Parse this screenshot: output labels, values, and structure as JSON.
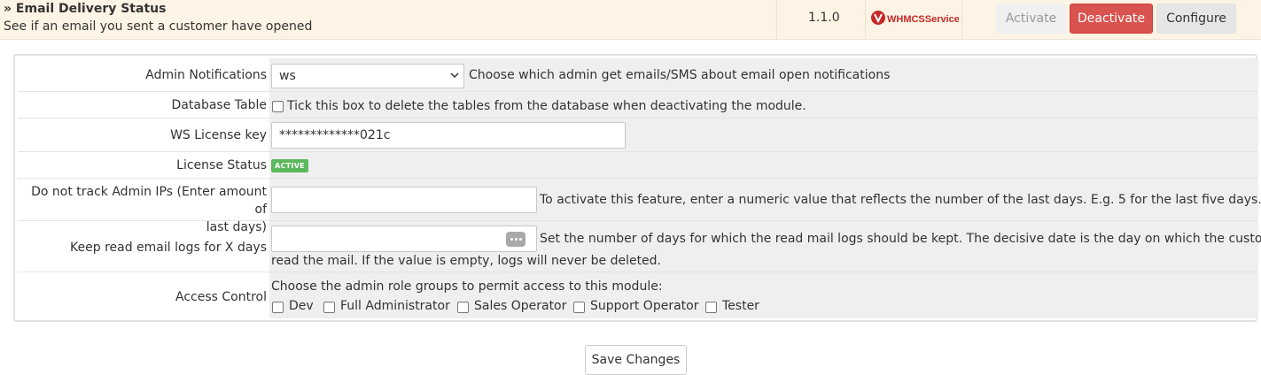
{
  "module": {
    "title": "» Email Delivery Status",
    "description": "See if an email you sent a customer have opened",
    "version": "1.1.0",
    "logo_text": "WHMCSServices",
    "activate_label": "Activate",
    "deactivate_label": "Deactivate",
    "configure_label": "Configure"
  },
  "settings": {
    "admin_notifications": {
      "label": "Admin Notifications",
      "selected": "ws",
      "help": "Choose which admin get emails/SMS about email open notifications"
    },
    "database_table": {
      "label": "Database Table",
      "checked": false,
      "help": "Tick this box to delete the tables from the database when deactivating the module."
    },
    "license_key": {
      "label": "WS License key",
      "value": "*************021c"
    },
    "license_status": {
      "label": "License Status",
      "badge": "ACTIVE"
    },
    "track_admin_ips": {
      "label_line1": "Do not track Admin IPs (Enter amount of",
      "label_line2": "last days)",
      "value": "",
      "help": "To activate this feature, enter a numeric value that reflects the number of the last days. E.g. 5 for the last five days."
    },
    "keep_logs": {
      "label": "Keep read email logs for X days",
      "value": "",
      "help_line1": "Set the number of days for which the read mail logs should be kept. The decisive date is the day on which the customer last",
      "help_line2": "read the mail. If the value is empty, logs will never be deleted."
    },
    "access_control": {
      "label": "Access Control",
      "help": "Choose the admin role groups to permit access to this module:",
      "roles": [
        "Dev",
        "Full Administrator",
        "Sales Operator",
        "Support Operator",
        "Tester"
      ]
    }
  },
  "save_label": "Save Changes",
  "colors": {
    "deactivate": "#d9534f",
    "badge_active": "#5cb85c",
    "top_bar": "#fdf4e5"
  }
}
